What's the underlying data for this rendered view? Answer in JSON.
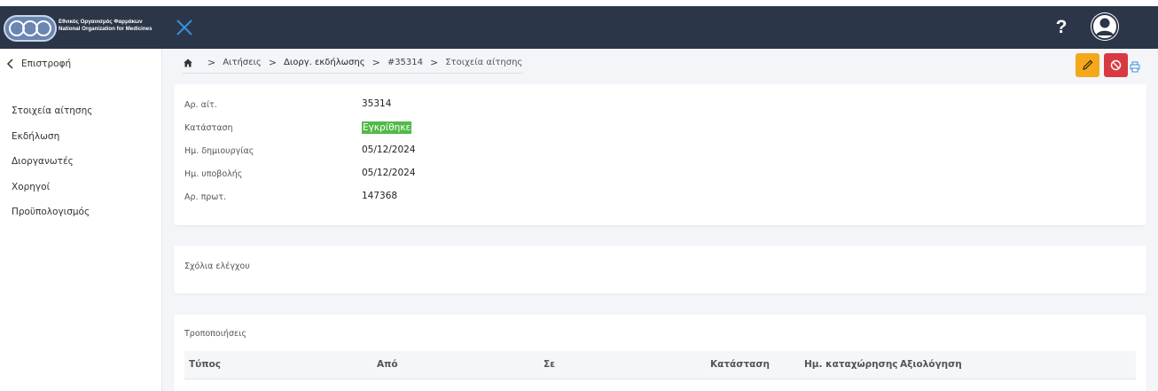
{
  "header": {
    "logo_line1": "Εθνικός Οργανισμός Φαρμάκων",
    "logo_line2": "National Organization for Medicines",
    "help_label": "?"
  },
  "sidebar": {
    "back_label": "Επιστροφή",
    "items": [
      {
        "label": "Στοιχεία αίτησης"
      },
      {
        "label": "Εκδήλωση"
      },
      {
        "label": "Διοργανωτές"
      },
      {
        "label": "Χορηγοί"
      },
      {
        "label": "Προϋπολογισμός"
      }
    ]
  },
  "breadcrumb": {
    "items": [
      "Αιτήσεις",
      "Διοργ. εκδήλωσης",
      "#35314",
      "Στοιχεία αίτησης"
    ],
    "separator": ">"
  },
  "details": {
    "rows": [
      {
        "label": "Αρ. αίτ.",
        "value": "35314"
      },
      {
        "label": "Κατάσταση",
        "value": "Εγκρίθηκε"
      },
      {
        "label": "Ημ. δημιουργίας",
        "value": "05/12/2024"
      },
      {
        "label": "Ημ. υποβολής",
        "value": "05/12/2024"
      },
      {
        "label": "Αρ. πρωτ.",
        "value": "147368"
      }
    ]
  },
  "comments": {
    "title": "Σχόλια ελέγχου"
  },
  "modifications": {
    "title": "Τροποποιήσεις",
    "columns": [
      "Τύπος",
      "Από",
      "Σε",
      "Κατάσταση",
      "Ημ. καταχώρησης",
      "Αξιολόγηση"
    ]
  },
  "colors": {
    "header_bg": "#2b3648",
    "status_approved": "#52b948",
    "edit_button": "#f4a81b",
    "cancel_button": "#d93a42",
    "accent_blue": "#3a8fd9"
  },
  "icons": {
    "close": "close-icon",
    "help": "help-icon",
    "avatar": "user-avatar-icon",
    "back": "chevron-left-icon",
    "home": "home-icon",
    "edit": "pencil-icon",
    "cancel": "ban-icon",
    "print": "printer-icon"
  }
}
